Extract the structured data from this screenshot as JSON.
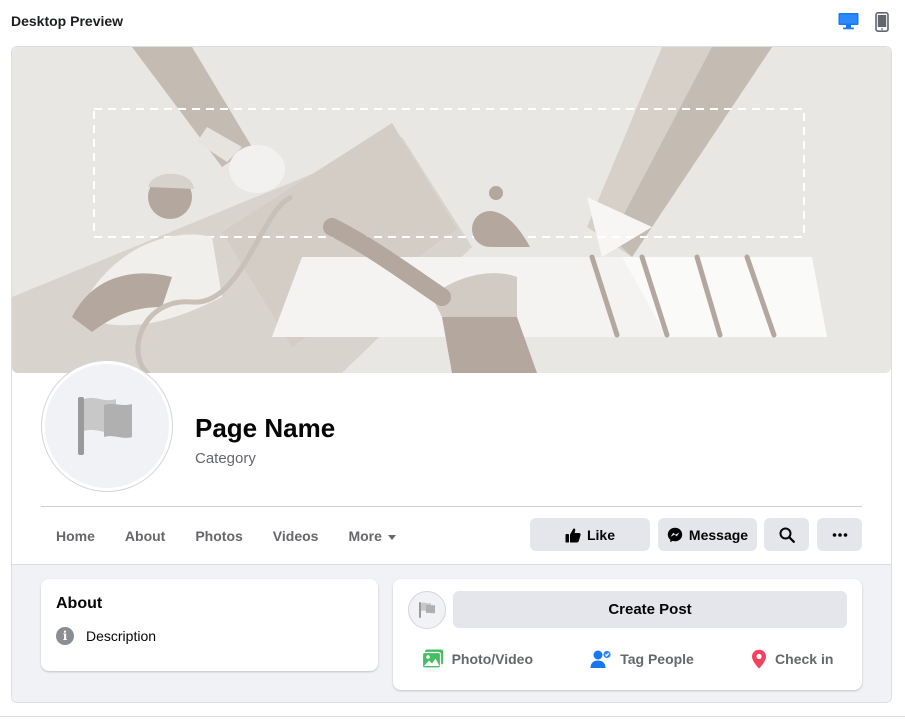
{
  "header": {
    "title": "Desktop Preview",
    "desktop_icon": "desktop-monitor-icon",
    "mobile_icon": "mobile-phone-icon",
    "active_color": "#1877f2"
  },
  "page": {
    "name": "Page Name",
    "category": "Category"
  },
  "nav": {
    "items": [
      "Home",
      "About",
      "Photos",
      "Videos",
      "More"
    ]
  },
  "actions": {
    "like_label": "Like",
    "message_label": "Message"
  },
  "about": {
    "title": "About",
    "description": "Description"
  },
  "post": {
    "create_label": "Create Post",
    "photo_video": "Photo/Video",
    "tag_people": "Tag People",
    "check_in": "Check in"
  },
  "colors": {
    "cover_bg": "#e9e7e4",
    "illustration": "#bdb3ab",
    "button_bg": "#e4e6eb",
    "photo_green": "#45bd62",
    "tag_blue": "#1877f2",
    "checkin_red": "#f3425f"
  }
}
